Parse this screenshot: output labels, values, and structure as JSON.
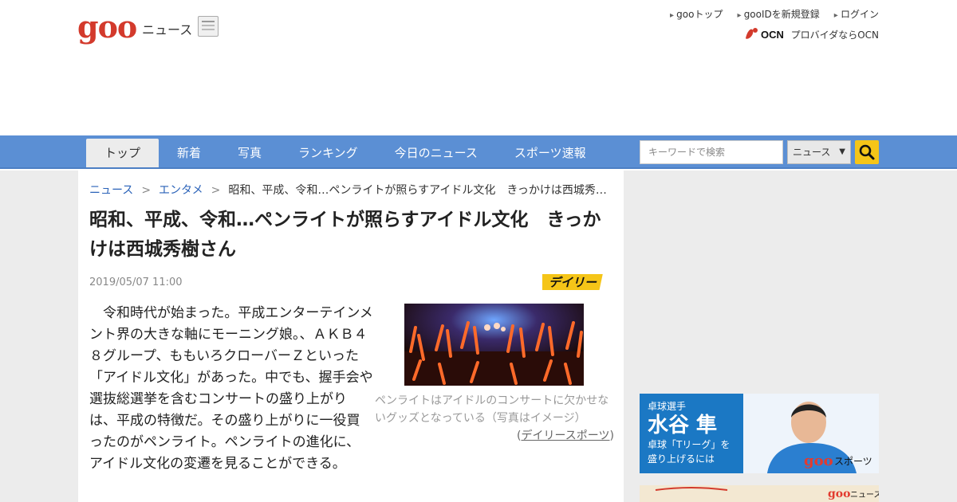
{
  "header": {
    "logo": "goo",
    "logo_sub": "ニュース",
    "links": [
      "gooトップ",
      "gooIDを新規登録",
      "ログイン"
    ],
    "ocn_logo": "OCN",
    "ocn_text": "プロバイダならOCN"
  },
  "nav": {
    "tabs": [
      {
        "label": "トップ"
      },
      {
        "label": "新着"
      },
      {
        "label": "写真"
      },
      {
        "label": "ランキング"
      },
      {
        "label": "今日のニュース"
      },
      {
        "label": "スポーツ速報"
      }
    ],
    "search_placeholder": "キーワードで検索",
    "search_scope": "ニュース"
  },
  "breadcrumb": {
    "items": [
      "ニュース",
      "エンタメ"
    ],
    "current": "昭和、平成、令和…ペンライトが照らすアイドル文化　きっかけは西城秀…",
    "separator": ">"
  },
  "article": {
    "title": "昭和、平成、令和…ペンライトが照らすアイドル文化　きっかけは西城秀樹さん",
    "date": "2019/05/07 11:00",
    "source_logo": "デイリー",
    "body": "令和時代が始まった。平成エンターテインメント界の大きな軸にモーニング娘。、ＡＫＢ４８グループ、ももいろクローバーＺといった「アイドル文化」があった。中でも、握手会や選抜総選挙を含むコンサートの盛り上がりは、平成の特徴だ。その盛り上がりに一役買ったのがペンライト。ペンライトの進化に、アイドル文化の変遷を見ることができる。",
    "photo_caption": "ペンライトはアイドルのコンサートに欠かせないグッズとなっている（写真はイメージ）",
    "credit_open": "(",
    "credit_link": "デイリースポーツ",
    "credit_close": ")"
  },
  "ads": {
    "ad1": {
      "tag": "卓球選手",
      "name": "水谷 隼",
      "line1": "卓球「Tリーグ」を",
      "line2": "盛り上げるには",
      "brand": "goo",
      "brand_sub": "スポーツ"
    },
    "ad2": {
      "brand": "goo",
      "brand_sub": "ニュース"
    }
  },
  "colors": {
    "nav_bg": "#5b8fd4",
    "logo_red": "#d33a2c",
    "link_blue": "#2a62b8",
    "search_button": "#f5c518"
  }
}
